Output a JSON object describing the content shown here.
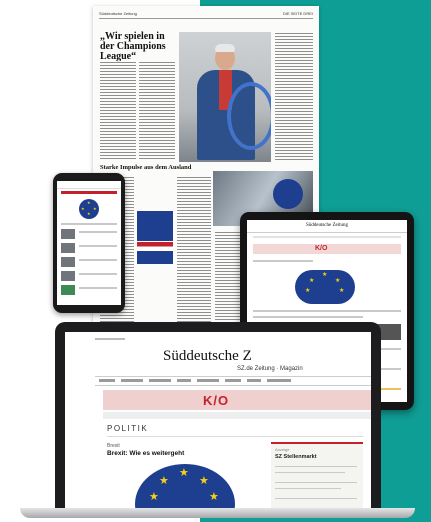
{
  "newspaper": {
    "header_left": "Süddeutsche Zeitung",
    "header_right": "DIE SEITE DREI",
    "headline": "„Wir spielen in der Champions League“",
    "section_headline": "Starke Impulse aus dem Ausland"
  },
  "tablet": {
    "masthead": "Süddeutsche Zeitung",
    "kiosk_logo": "K/O"
  },
  "laptop": {
    "masthead": "Süddeutsche Z",
    "masthead_sub": "SZ.de Zeitung · Magazin",
    "kiosk_logo": "K/O",
    "section": "POLITIK",
    "kicker": "Brexit",
    "headline": "Brexit: Wie es weitergeht",
    "sidebar_label": "Anzeige",
    "sidebar_title": "SZ Stellenmarkt"
  },
  "colors": {
    "teal": "#0f9e95",
    "sz_red": "#c5212d",
    "eu_blue": "#1e3f8f",
    "eu_gold": "#f5d313"
  }
}
